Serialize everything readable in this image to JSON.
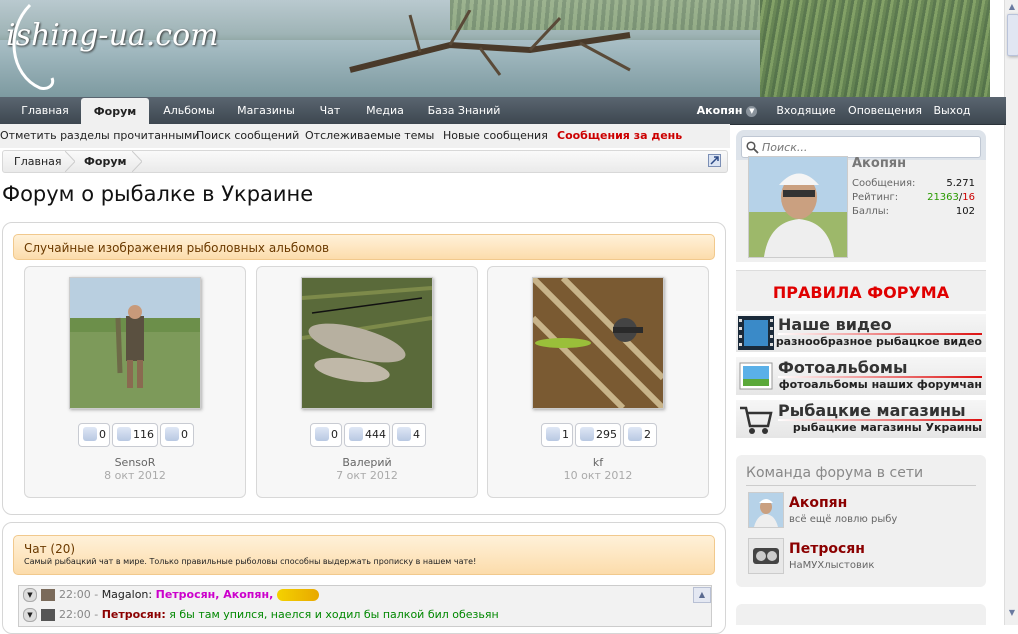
{
  "header": {
    "logo_text": "ishing-ua.com"
  },
  "nav": {
    "tabs": [
      {
        "label": "Главная"
      },
      {
        "label": "Форум"
      },
      {
        "label": "Альбомы"
      },
      {
        "label": "Магазины"
      },
      {
        "label": "Чат"
      },
      {
        "label": "Медиа"
      },
      {
        "label": "База Знаний"
      }
    ],
    "user": "Акопян",
    "right": [
      {
        "label": "Входящие"
      },
      {
        "label": "Оповещения"
      },
      {
        "label": "Выход"
      }
    ]
  },
  "subnav": [
    {
      "label": "Отметить разделы прочитанными"
    },
    {
      "label": "Поиск сообщений"
    },
    {
      "label": "Отслеживаемые темы"
    },
    {
      "label": "Новые сообщения"
    },
    {
      "label": "Сообщения за день"
    }
  ],
  "breadcrumb": [
    {
      "label": "Главная"
    },
    {
      "label": "Форум"
    }
  ],
  "page_title": "Форум о рыбалке в Украине",
  "albums": {
    "heading": "Случайные изображения рыболовных альбомов",
    "cards": [
      {
        "comments": "0",
        "views": "116",
        "likes": "0",
        "user": "SensoR",
        "date": "8 окт 2012"
      },
      {
        "comments": "0",
        "views": "444",
        "likes": "4",
        "user": "Валерий",
        "date": "7 окт 2012"
      },
      {
        "comments": "1",
        "views": "295",
        "likes": "2",
        "user": "kf",
        "date": "10 окт 2012"
      }
    ]
  },
  "chat": {
    "heading": "Чат (20)",
    "subheading": "Самый рыбацкий чат в мире. Только правильные рыболовы способны выдержать прописку в нашем чате!",
    "messages": [
      {
        "time": "22:00",
        "sep": "-",
        "author": "Magalon:",
        "mentions": "Петросян, Акопян,",
        "text": ""
      },
      {
        "time": "22:00",
        "sep": "-",
        "author": "Петросян:",
        "mentions": "",
        "text": "я бы там упился, наелся и ходил бы палкой бил обезьян"
      }
    ]
  },
  "sidebar": {
    "search_placeholder": "Поиск...",
    "user": {
      "name": "Акопян",
      "messages_label": "Сообщения:",
      "messages_value": "5.271",
      "rating_label": "Рейтинг:",
      "rating_pos": "21363",
      "rating_sep": "/",
      "rating_neg": "16",
      "points_label": "Баллы:",
      "points_value": "102"
    },
    "rules": "ПРАВИЛА ФОРУМА",
    "promos": [
      {
        "title": "Наше видео",
        "sub": "разнообразное рыбацкое видео"
      },
      {
        "title": "Фотоальбомы",
        "sub": "фотоальбомы наших форумчан"
      },
      {
        "title": "Рыбацкие магазины",
        "sub": "рыбацкие магазины Украины"
      }
    ],
    "staff": {
      "heading": "Команда форума в сети",
      "members": [
        {
          "name": "Акопян",
          "status": "всё ещё ловлю рыбу"
        },
        {
          "name": "Петросян",
          "status": "НаМУХлыстовик"
        }
      ]
    }
  },
  "colors": {
    "accent_red": "#cc0000",
    "nav_bg": "#3d4750",
    "staff_name": "#8b0000",
    "mention": "#cc00cc",
    "chat_text": "#008800"
  }
}
